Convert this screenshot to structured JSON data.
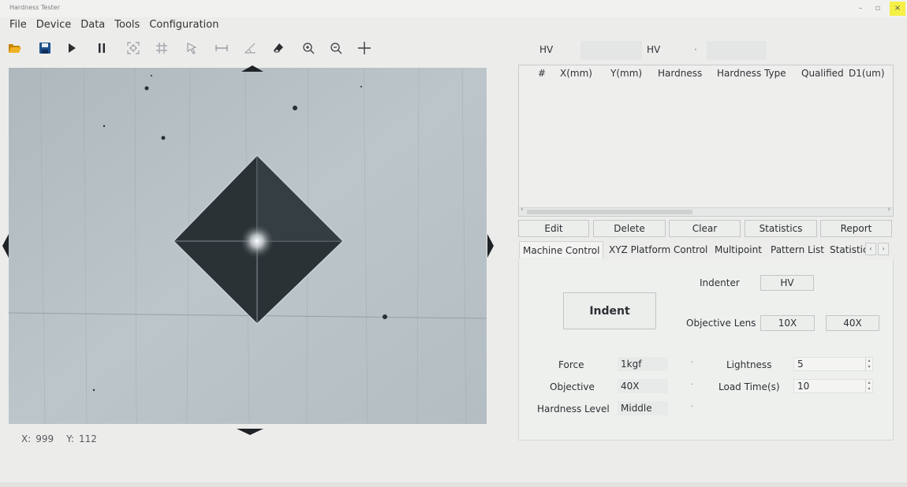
{
  "window": {
    "title": "Hardness Tester",
    "minimize": "–",
    "maximize": "▫",
    "close": "×"
  },
  "menu": [
    "File",
    "Device",
    "Data",
    "Tools",
    "Configuration"
  ],
  "toolbar_icons": [
    "open-folder-icon",
    "save-icon",
    "play-icon",
    "pause-icon",
    "focus-icon",
    "grid-icon",
    "pointer-icon",
    "horizontal-measure-icon",
    "angle-measure-icon",
    "eraser-icon",
    "zoom-in-icon",
    "zoom-out-icon",
    "crosshair-icon"
  ],
  "coords": {
    "x_label": "X:",
    "x_value": "999",
    "y_label": "Y:",
    "y_value": "112"
  },
  "hv_row": {
    "left": "HV",
    "right": "HV",
    "dropdown": "·"
  },
  "table": {
    "columns": [
      "#",
      "X(mm)",
      "Y(mm)",
      "Hardness",
      "Hardness Type",
      "Qualified",
      "D1(um)"
    ],
    "rows": [],
    "scroll_left": "‹",
    "scroll_right": "›"
  },
  "actions": [
    "Edit",
    "Delete",
    "Clear",
    "Statistics",
    "Report"
  ],
  "tabs": [
    "Machine Control",
    "XYZ Platform Control",
    "Multipoint",
    "Pattern List",
    "Statistic"
  ],
  "tab_scroll": [
    "‹",
    "›"
  ],
  "machine_control": {
    "indent_button": "Indent",
    "indenter_label": "Indenter",
    "indenter_value": "HV",
    "objective_lens_label": "Objective Lens",
    "lens_10x": "10X",
    "lens_40x": "40X",
    "force_label": "Force",
    "force_value": "1kgf",
    "objective_label": "Objective",
    "objective_value": "40X",
    "hardness_level_label": "Hardness Level",
    "hardness_level_value": "Middle",
    "lightness_label": "Lightness",
    "lightness_value": "5",
    "load_time_label": "Load Time(s)",
    "load_time_value": "10",
    "combo_arrow": "·",
    "spin_up": "▴",
    "spin_down": "▾"
  },
  "colors": {
    "accent_close": "#f5f046",
    "toolbar_folder": "#e7a20e",
    "toolbar_save": "#1f4f8a",
    "image_background": "#b3bec3",
    "indent_dark": "#2b3236"
  }
}
